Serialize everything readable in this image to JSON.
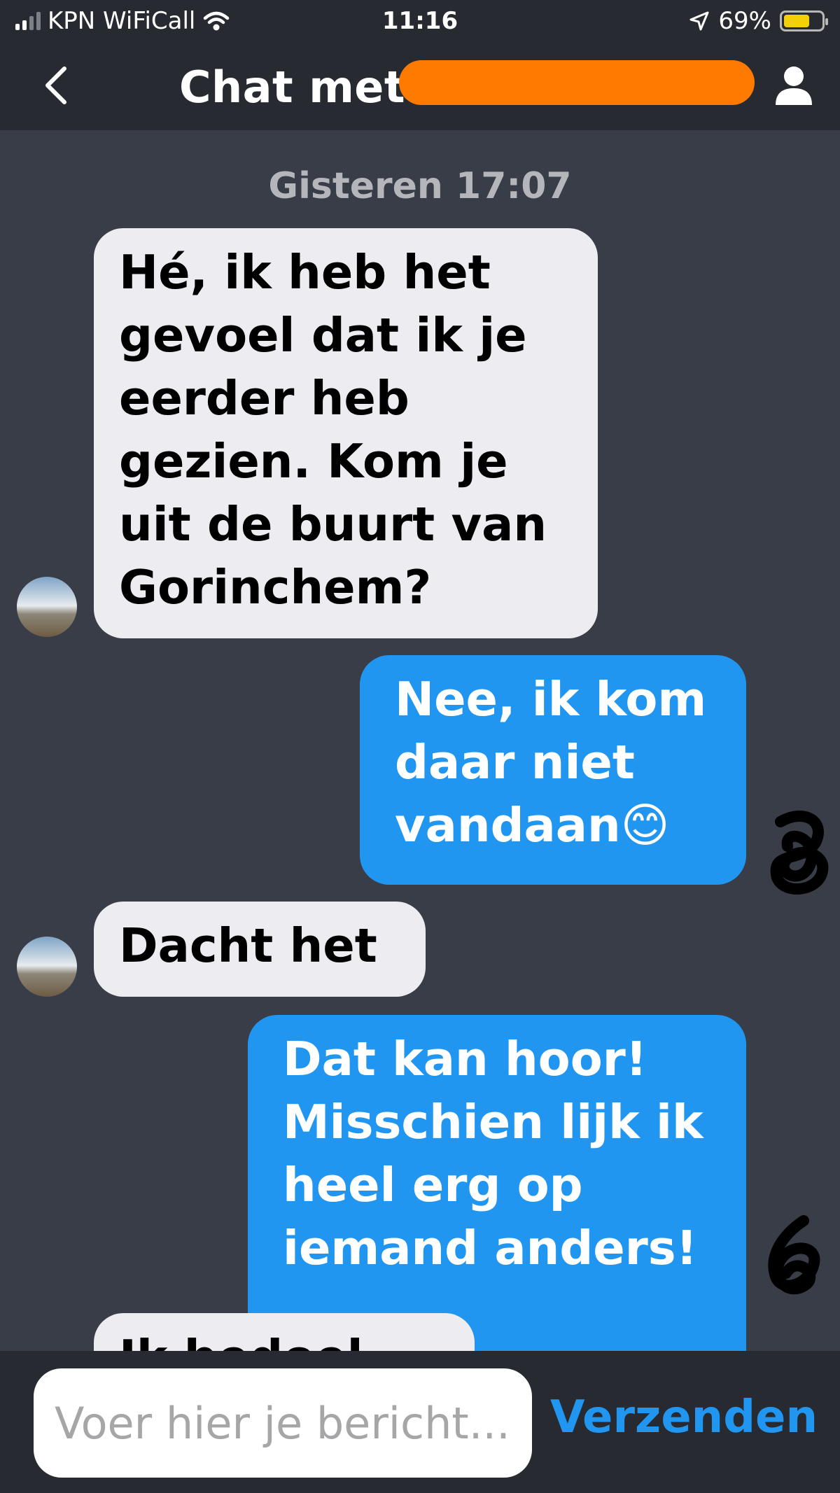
{
  "status_bar": {
    "carrier": "KPN WiFiCall",
    "time": "11:16",
    "battery": "69%",
    "battery_level": 0.69
  },
  "header": {
    "title": "Chat met"
  },
  "chat": {
    "date_separator": "Gisteren 17:07",
    "messages": [
      {
        "direction": "incoming",
        "text": "Hé, ik heb het gevoel dat ik je eerder heb gezien. Kom je uit de buurt van Gorinchem?"
      },
      {
        "direction": "outgoing",
        "text": "Nee, ik kom daar niet vandaan😊"
      },
      {
        "direction": "incoming",
        "text": "Dacht het"
      },
      {
        "direction": "outgoing",
        "text": "Dat kan hoor! Misschien lijk ik heel erg op iemand anders!"
      },
      {
        "direction": "incoming",
        "text": "Ik bedoel"
      }
    ]
  },
  "composer": {
    "placeholder": "Voer hier je bericht...",
    "send_label": "Verzenden"
  },
  "colors": {
    "accent": "#2196f0",
    "redaction": "#ff7a00",
    "background": "#393d48",
    "bars": "#272a31",
    "incoming_bubble": "#ececf1"
  }
}
